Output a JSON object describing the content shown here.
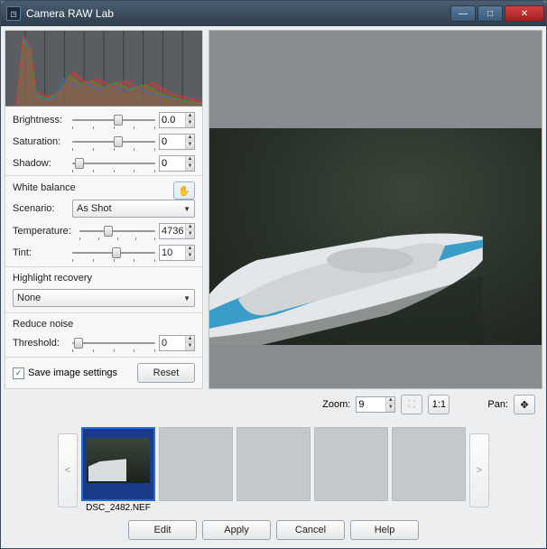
{
  "window": {
    "title": "Camera RAW Lab"
  },
  "adjust": {
    "brightness": {
      "label": "Brightness:",
      "value": "0.0",
      "pos": 50
    },
    "saturation": {
      "label": "Saturation:",
      "value": "0",
      "pos": 50
    },
    "shadow": {
      "label": "Shadow:",
      "value": "0",
      "pos": 5
    }
  },
  "wb": {
    "title": "White balance",
    "scenario_label": "Scenario:",
    "scenario_value": "As Shot",
    "temperature": {
      "label": "Temperature:",
      "value": "4736",
      "pos": 35
    },
    "tint": {
      "label": "Tint:",
      "value": "10",
      "pos": 48
    }
  },
  "highlight": {
    "title": "Highlight recovery",
    "value": "None"
  },
  "noise": {
    "title": "Reduce noise",
    "threshold": {
      "label": "Threshold:",
      "value": "0",
      "pos": 3
    }
  },
  "save": {
    "checked": true,
    "label": "Save image settings",
    "reset": "Reset"
  },
  "zoom": {
    "label": "Zoom:",
    "value": "9",
    "pan_label": "Pan:"
  },
  "icons": {
    "fit": "⛶",
    "oneone": "1:1",
    "pan": "✥",
    "eyedrop": "✋"
  },
  "filmstrip": {
    "selected_name": "DSC_2482.NEF"
  },
  "buttons": {
    "edit": "Edit",
    "apply": "Apply",
    "cancel": "Cancel",
    "help": "Help"
  }
}
